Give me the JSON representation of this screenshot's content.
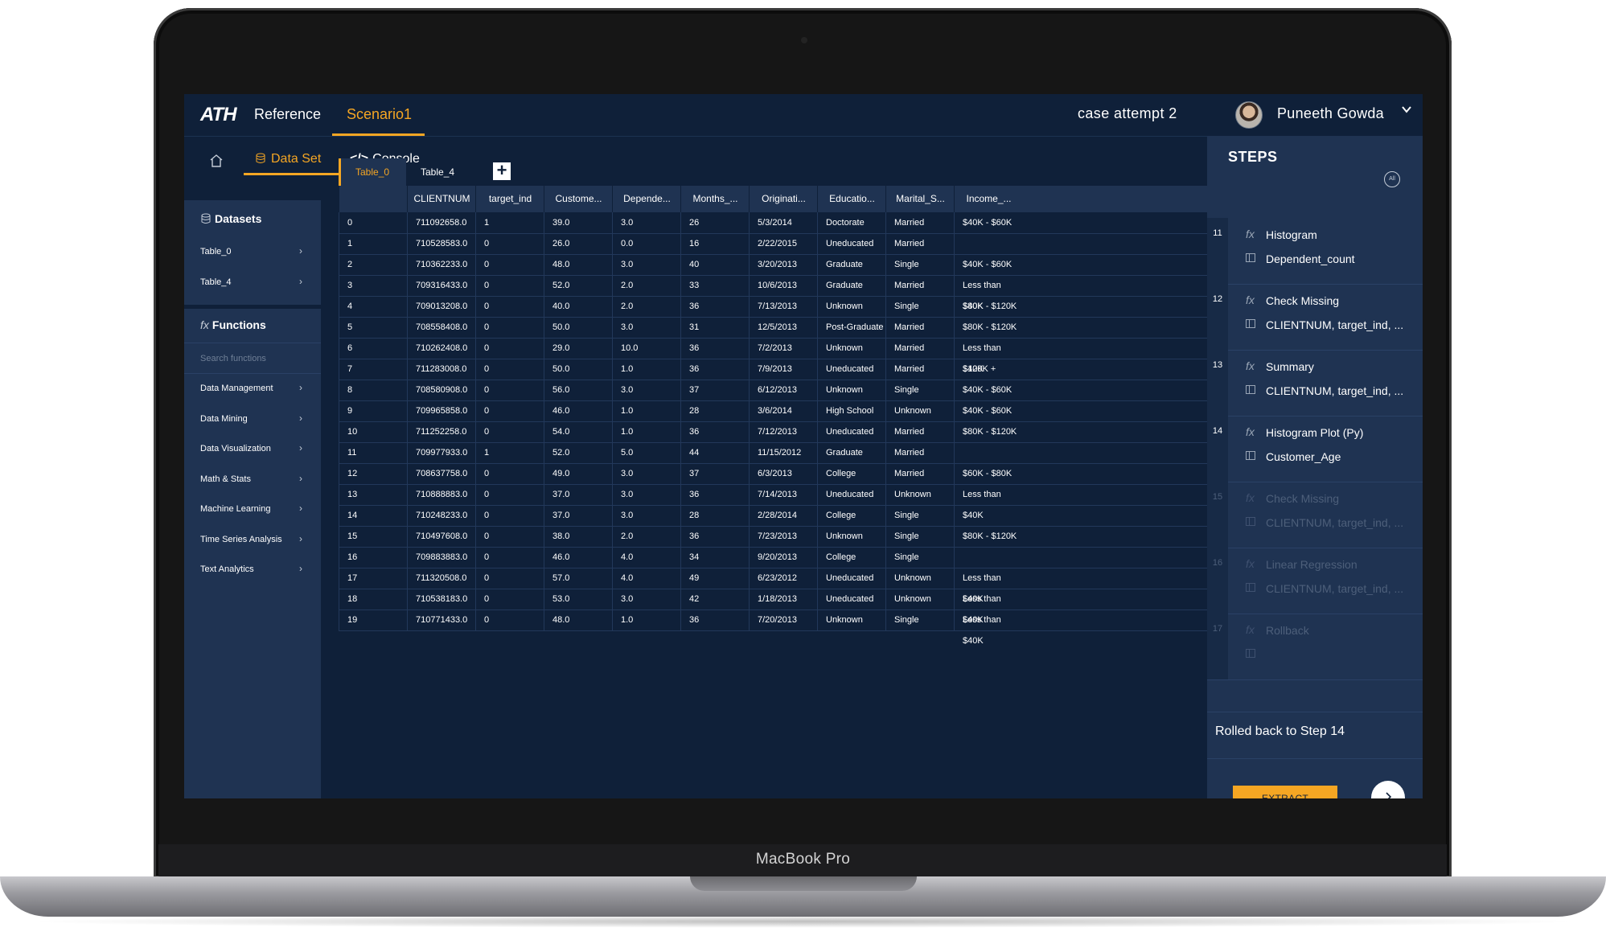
{
  "device": {
    "label": "MacBook Pro"
  },
  "app": {
    "logo": "ATH",
    "tabs": [
      {
        "label": "Reference",
        "active": false
      },
      {
        "label": "Scenario1",
        "active": true
      }
    ],
    "case_title": "case attempt 2",
    "user_name": "Puneeth Gowda"
  },
  "subnav": {
    "tabs": [
      {
        "label": "Data Set",
        "active": true
      },
      {
        "label": "Console",
        "active": false
      }
    ]
  },
  "sidebar": {
    "datasets_title": "Datasets",
    "datasets": [
      "Table_0",
      "Table_4"
    ],
    "functions_title": "Functions",
    "search_placeholder": "Search functions",
    "function_groups": [
      "Data Management",
      "Data Mining",
      "Data Visualization",
      "Math & Stats",
      "Machine Learning",
      "Time Series Analysis",
      "Text Analytics"
    ]
  },
  "table_tabs": [
    "Table_0",
    "Table_4"
  ],
  "table": {
    "columns": [
      "",
      "CLIENTNUM",
      "target_ind",
      "Custome...",
      "Depende...",
      "Months_...",
      "Originati...",
      "Educatio...",
      "Marital_S...",
      "Income_..."
    ],
    "rows": [
      [
        "0",
        "711092658.0",
        "1",
        "39.0",
        "3.0",
        "26",
        "5/3/2014",
        "Doctorate",
        "Married",
        "$40K - $60K"
      ],
      [
        "1",
        "710528583.0",
        "0",
        "26.0",
        "0.0",
        "16",
        "2/22/2015",
        "Uneducated",
        "Married",
        ""
      ],
      [
        "2",
        "710362233.0",
        "0",
        "48.0",
        "3.0",
        "40",
        "3/20/2013",
        "Graduate",
        "Single",
        "$40K - $60K"
      ],
      [
        "3",
        "709316433.0",
        "0",
        "52.0",
        "2.0",
        "33",
        "10/6/2013",
        "Graduate",
        "Married",
        "Less than $40K"
      ],
      [
        "4",
        "709013208.0",
        "0",
        "40.0",
        "2.0",
        "36",
        "7/13/2013",
        "Unknown",
        "Single",
        "$80K - $120K"
      ],
      [
        "5",
        "708558408.0",
        "0",
        "50.0",
        "3.0",
        "31",
        "12/5/2013",
        "Post-Graduate",
        "Married",
        "$80K - $120K"
      ],
      [
        "6",
        "710262408.0",
        "0",
        "29.0",
        "10.0",
        "36",
        "7/2/2013",
        "Unknown",
        "Married",
        "Less than $40K"
      ],
      [
        "7",
        "711283008.0",
        "0",
        "50.0",
        "1.0",
        "36",
        "7/9/2013",
        "Uneducated",
        "Married",
        "$120K +"
      ],
      [
        "8",
        "708580908.0",
        "0",
        "56.0",
        "3.0",
        "37",
        "6/12/2013",
        "Unknown",
        "Single",
        "$40K - $60K"
      ],
      [
        "9",
        "709965858.0",
        "0",
        "46.0",
        "1.0",
        "28",
        "3/6/2014",
        "High School",
        "Unknown",
        "$40K - $60K"
      ],
      [
        "10",
        "711252258.0",
        "0",
        "54.0",
        "1.0",
        "36",
        "7/12/2013",
        "Uneducated",
        "Married",
        "$80K - $120K"
      ],
      [
        "11",
        "709977933.0",
        "1",
        "52.0",
        "5.0",
        "44",
        "11/15/2012",
        "Graduate",
        "Married",
        ""
      ],
      [
        "12",
        "708637758.0",
        "0",
        "49.0",
        "3.0",
        "37",
        "6/3/2013",
        "College",
        "Married",
        "$60K - $80K"
      ],
      [
        "13",
        "710888883.0",
        "0",
        "37.0",
        "3.0",
        "36",
        "7/14/2013",
        "Uneducated",
        "Unknown",
        "Less than $40K"
      ],
      [
        "14",
        "710248233.0",
        "0",
        "37.0",
        "3.0",
        "28",
        "2/28/2014",
        "College",
        "Single",
        ""
      ],
      [
        "15",
        "710497608.0",
        "0",
        "38.0",
        "2.0",
        "36",
        "7/23/2013",
        "Unknown",
        "Single",
        "$80K - $120K"
      ],
      [
        "16",
        "709883883.0",
        "0",
        "46.0",
        "4.0",
        "34",
        "9/20/2013",
        "College",
        "Single",
        ""
      ],
      [
        "17",
        "711320508.0",
        "0",
        "57.0",
        "4.0",
        "49",
        "6/23/2012",
        "Uneducated",
        "Unknown",
        "Less than $40K"
      ],
      [
        "18",
        "710538183.0",
        "0",
        "53.0",
        "3.0",
        "42",
        "1/18/2013",
        "Uneducated",
        "Unknown",
        "Less than $40K"
      ],
      [
        "19",
        "710771433.0",
        "0",
        "48.0",
        "1.0",
        "36",
        "7/20/2013",
        "Unknown",
        "Single",
        "Less than $40K"
      ]
    ]
  },
  "steps_panel": {
    "title": "STEPS",
    "reset_icon_text": "All",
    "steps": [
      {
        "num": "11",
        "fn": "Histogram",
        "args": "Dependent_count",
        "faded": false
      },
      {
        "num": "12",
        "fn": "Check Missing",
        "args": "CLIENTNUM, target_ind, ...",
        "faded": false
      },
      {
        "num": "13",
        "fn": "Summary",
        "args": "CLIENTNUM, target_ind, ...",
        "faded": false
      },
      {
        "num": "14",
        "fn": "Histogram Plot (Py)",
        "args": "Customer_Age",
        "faded": false
      },
      {
        "num": "15",
        "fn": "Check Missing",
        "args": "CLIENTNUM, target_ind, ...",
        "faded": true
      },
      {
        "num": "16",
        "fn": "Linear Regression",
        "args": "CLIENTNUM, target_ind, ...",
        "faded": true
      },
      {
        "num": "17",
        "fn": "Rollback",
        "args": "",
        "faded": true
      }
    ],
    "status": "Rolled back to Step 14",
    "extract_label": "EXTRACT"
  },
  "colors": {
    "accent": "#f5a623",
    "background": "#0f2039",
    "panel": "#1f3352"
  }
}
